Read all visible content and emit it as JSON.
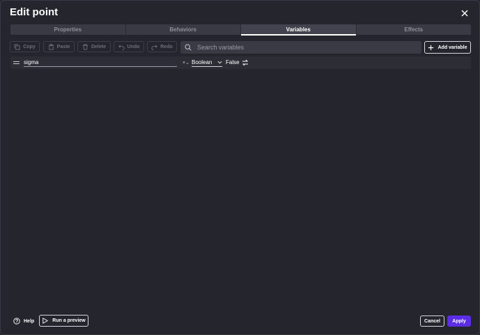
{
  "dialog": {
    "title": "Edit point",
    "close_icon": "close-icon"
  },
  "tabs": [
    {
      "label": "Properties",
      "active": false
    },
    {
      "label": "Behaviors",
      "active": false
    },
    {
      "label": "Variables",
      "active": true
    },
    {
      "label": "Effects",
      "active": false
    }
  ],
  "toolbar": {
    "copy_label": "Copy",
    "paste_label": "Paste",
    "delete_label": "Delete",
    "undo_label": "Undo",
    "redo_label": "Redo",
    "search_placeholder": "Search variables",
    "search_value": "",
    "add_variable_label": "Add variable"
  },
  "variables": [
    {
      "name": "sigma",
      "type_icon": "×⌄",
      "type": "Boolean",
      "value": "False"
    }
  ],
  "footer": {
    "help_label": "Help",
    "run_preview_label": "Run a preview",
    "cancel_label": "Cancel",
    "apply_label": "Apply"
  },
  "colors": {
    "background": "#25252e",
    "tab_bar": "#3a3a44",
    "accent": "#5b2ee6"
  }
}
